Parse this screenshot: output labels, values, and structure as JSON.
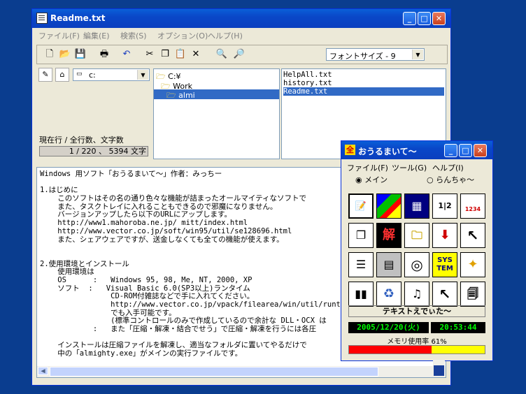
{
  "main_window": {
    "title": "Readme.txt",
    "menu": [
      "ファイル(F)",
      "編集(E)",
      "検索(S)",
      "オプション(O)",
      "ヘルプ(H)"
    ],
    "font_size_select": "フォントサイズ - 9",
    "drive_select": "c:",
    "folders": [
      "C:¥",
      "Work",
      "almi"
    ],
    "files": [
      "HelpAll.txt",
      "history.txt",
      "Readme.txt"
    ],
    "status_label": "現在行 / 全行数、文字数",
    "status_value": "1 / 220 、 5394 文字",
    "text_lines": [
      "Windows 用ソフト「おうるまいて～」作者：みっちー",
      "",
      "1.はじめに",
      "    このソフトはその名の通り色々な機能が詰まったオールマイティなソフトで",
      "    また、タスクトレイに入れることもできるので邪魔になりません。",
      "    バージョンアップしたら以下のURLにアップします。",
      "    http://www1.mahoroba.ne.jp/ mitt/index.html",
      "    http://www.vector.co.jp/soft/win95/util/se128696.html",
      "    また、シェアウェアですが、送金しなくても全ての機能が使えます。",
      "",
      "",
      "2.使用環境とインストール",
      "    使用環境は",
      "    OS      :   Windows 95, 98, Me, NT, 2000, XP",
      "    ソフト  :   Visual Basic 6.0(SP3以上)ランタイム",
      "                CD-ROM付雑誌などで手に入れてください。",
      "                http://www.vector.co.jp/vpack/filearea/win/util/runtime/",
      "                でも入手可能です。",
      "                (標準コントロールのみで作成しているので余計な DLL・OCX は",
      "            :   また「圧縮・解凍・結合でせう」で圧縮・解凍を行うには各圧",
      "",
      "    インストールは圧縮ファイルを解凍し、適当なフォルダに置いてやるだけで",
      "    中の「almighty.exe」がメインの実行ファイルです。"
    ]
  },
  "launcher_window": {
    "title": "おうるまいて～",
    "menu": [
      "ファイル(F)",
      "ツール(G)",
      "ヘルプ(I)"
    ],
    "radio_main": "メイン",
    "radio_launcher": "らんちゃ～",
    "selected_label": "テキストえでぃた～",
    "date": "2005/12/20(火)",
    "time": "20:53:44",
    "memory_label": "メモリ使用率 61%",
    "memory_percent": 61,
    "grid_kai": "解",
    "grid_system_1": "SYS",
    "grid_system_2": "TEM",
    "colors": {
      "lcd_bg": "#000000",
      "lcd_fg": "#00ff00",
      "mem_used": "#ff0000",
      "mem_free": "#ffff00"
    }
  }
}
